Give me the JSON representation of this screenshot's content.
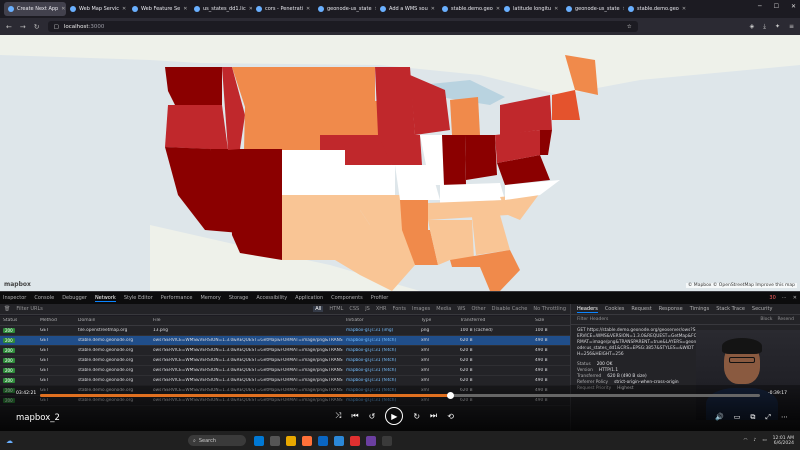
{
  "browser": {
    "tabs": [
      {
        "label": "Create Next App",
        "active": true
      },
      {
        "label": "Web Map Servic"
      },
      {
        "label": "Web Feature Se"
      },
      {
        "label": "us_states_dd1.lic"
      },
      {
        "label": "cors - Penetrati"
      },
      {
        "label": "geonode-us_state"
      },
      {
        "label": "Add a WMS sou"
      },
      {
        "label": "stable.demo.geo"
      },
      {
        "label": "latitude longitu"
      },
      {
        "label": "geonode-us_state"
      },
      {
        "label": "stable.demo.geo"
      }
    ],
    "url": "localhost",
    "url_port": ":3000"
  },
  "map": {
    "logo": "mapbox",
    "attribution": "© Mapbox © OpenStreetMap Improve this map",
    "colors": {
      "darkest": "#8b0000",
      "dark": "#c0282c",
      "mid": "#e4532d",
      "orange": "#f08a4b",
      "light": "#f9c595",
      "pale": "#fde6cf",
      "white": "#ffffff"
    }
  },
  "devtools": {
    "tabs": [
      "Inspector",
      "Console",
      "Debugger",
      "Network",
      "Style Editor",
      "Performance",
      "Memory",
      "Storage",
      "Accessibility",
      "Application",
      "Components",
      "Profiler"
    ],
    "active_tab": "Network",
    "filter_placeholder": "Filter URLs",
    "types": [
      "All",
      "HTML",
      "CSS",
      "JS",
      "XHR",
      "Fonts",
      "Images",
      "Media",
      "WS",
      "Other"
    ],
    "active_type": "All",
    "disable_cache": "Disable Cache",
    "throttle": "No Throttling",
    "error_count": "30",
    "columns": [
      "Status",
      "Method",
      "Domain",
      "File",
      "Initiator",
      "Type",
      "Transferred",
      "Size"
    ],
    "rows": [
      {
        "status": "200",
        "method": "GET",
        "domain": "tile.openstreetmap.org",
        "file": "13.png",
        "initiator": "mapbox-gl.js:31 (img)",
        "type": "png",
        "transferred": "100 B (cached)",
        "size": "100 B"
      },
      {
        "status": "200",
        "method": "GET",
        "domain": "stable.demo.geonode.org",
        "file": "ows?SERVICE=WMS&VERSION=1.3.0&REQUEST=GetMap&FORMAT=image/png&TRANS",
        "initiator": "mapbox-gl.js:31 (fetch)",
        "type": "xml",
        "transferred": "620 B",
        "size": "490 B",
        "selected": true
      },
      {
        "status": "200",
        "method": "GET",
        "domain": "stable.demo.geonode.org",
        "file": "ows?SERVICE=WMS&VERSION=1.3.0&REQUEST=GetMap&FORMAT=image/png&TRANS",
        "initiator": "mapbox-gl.js:31 (fetch)",
        "type": "xml",
        "transferred": "620 B",
        "size": "490 B"
      },
      {
        "status": "200",
        "method": "GET",
        "domain": "stable.demo.geonode.org",
        "file": "ows?SERVICE=WMS&VERSION=1.3.0&REQUEST=GetMap&FORMAT=image/png&TRANS",
        "initiator": "mapbox-gl.js:31 (fetch)",
        "type": "xml",
        "transferred": "620 B",
        "size": "490 B"
      },
      {
        "status": "200",
        "method": "GET",
        "domain": "stable.demo.geonode.org",
        "file": "ows?SERVICE=WMS&VERSION=1.3.0&REQUEST=GetMap&FORMAT=image/png&TRANS",
        "initiator": "mapbox-gl.js:31 (fetch)",
        "type": "xml",
        "transferred": "620 B",
        "size": "490 B"
      },
      {
        "status": "200",
        "method": "GET",
        "domain": "stable.demo.geonode.org",
        "file": "ows?SERVICE=WMS&VERSION=1.3.0&REQUEST=GetMap&FORMAT=image/png&TRANS",
        "initiator": "mapbox-gl.js:31 (fetch)",
        "type": "xml",
        "transferred": "620 B",
        "size": "490 B"
      },
      {
        "status": "200",
        "method": "GET",
        "domain": "stable.demo.geonode.org",
        "file": "ows?SERVICE=WMS&VERSION=1.3.0&REQUEST=GetMap&FORMAT=image/png&TRANS",
        "initiator": "mapbox-gl.js:31 (fetch)",
        "type": "xml",
        "transferred": "620 B",
        "size": "490 B"
      },
      {
        "status": "200",
        "method": "GET",
        "domain": "stable.demo.geonode.org",
        "file": "ows?SERVICE=WMS&VERSION=1.3.0&REQUEST=GetMap&FORMAT=image/png&TRANS",
        "initiator": "mapbox-gl.js:31 (fetch)",
        "type": "xml",
        "transferred": "620 B",
        "size": "490 B"
      }
    ],
    "side": {
      "tabs": [
        "Headers",
        "Cookies",
        "Request",
        "Response",
        "Timings",
        "Stack Trace",
        "Security"
      ],
      "active_tab": "Headers",
      "filter_placeholder": "Filter Headers",
      "block": "Block",
      "resend": "Resend",
      "request_line": "GET https://stable.demo.geonode.org/geoserver/ows?SERVICE=WMS&VERSION=1.3.0&REQUEST=GetMap&FORMAT=image/png&TRANSPARENT=true&LAYERS=geonode:us_states_dd1&CRS=EPSG:3857&STYLES=&WIDTH=256&HEIGHT=256",
      "fields": [
        {
          "k": "Status",
          "v": "200 OK"
        },
        {
          "k": "Version",
          "v": "HTTP/1.1"
        },
        {
          "k": "Transferred",
          "v": "620 B (490 B size)"
        },
        {
          "k": "Referrer Policy",
          "v": "strict-origin-when-cross-origin"
        },
        {
          "k": "Request Priority",
          "v": "Highest"
        }
      ]
    }
  },
  "player": {
    "current_time": "03:42:21",
    "total_time": "-0:39:17",
    "progress": 0.57,
    "title": "mapbox_2"
  },
  "taskbar": {
    "search_placeholder": "Search",
    "time": "12:01 AM",
    "date": "6/6/2024"
  }
}
